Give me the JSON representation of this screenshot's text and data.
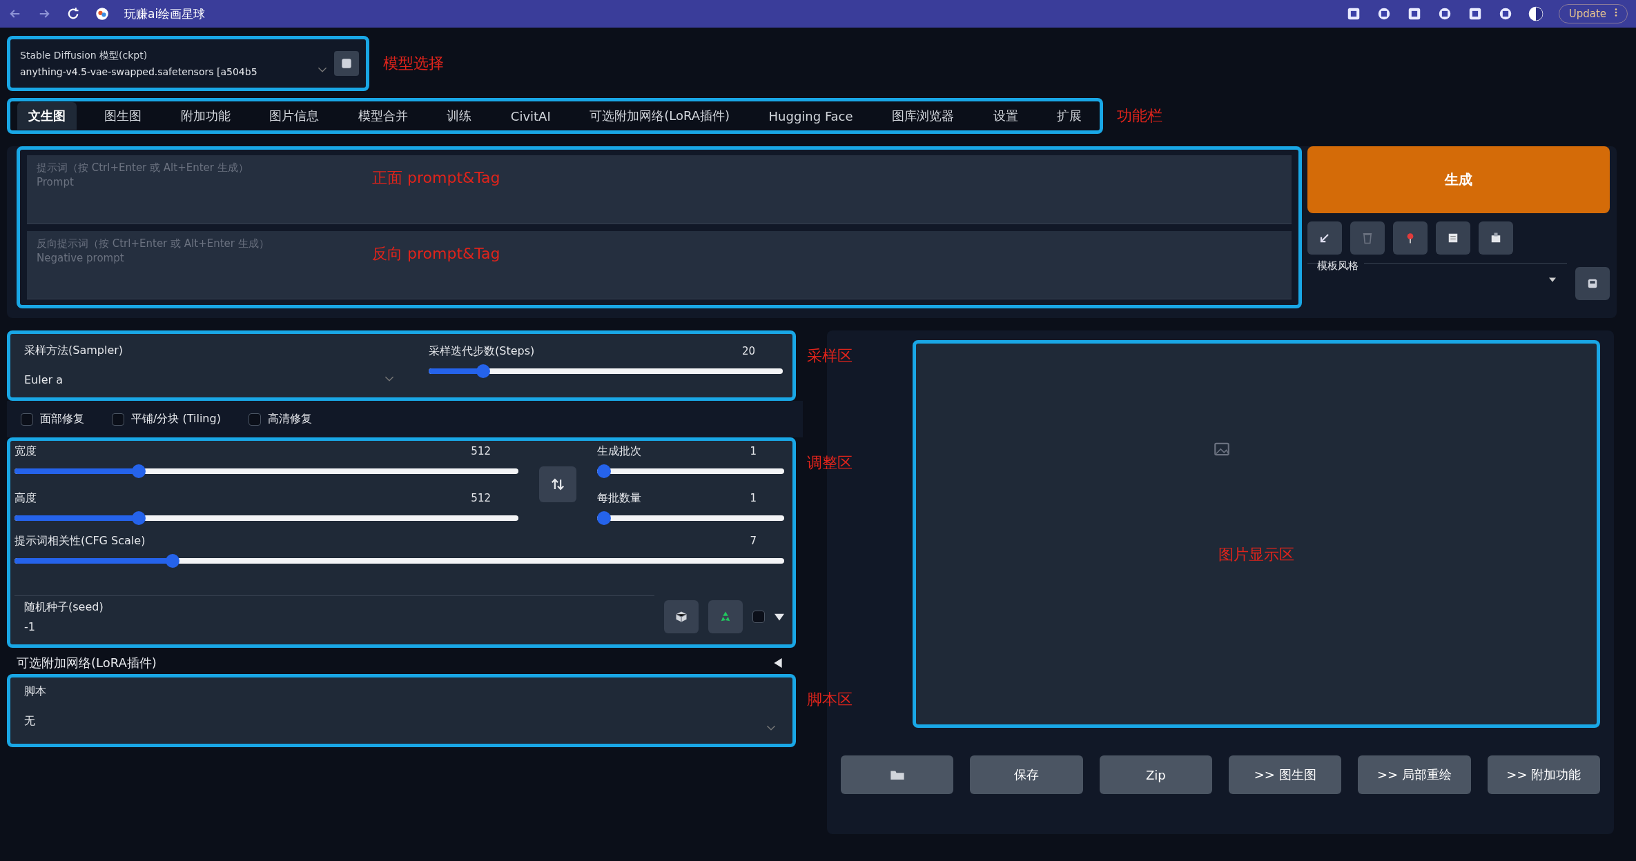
{
  "browser": {
    "tab_title": "玩赚ai绘画星球",
    "update_button": "Update"
  },
  "model_select": {
    "label": "Stable Diffusion 模型(ckpt)",
    "value": "anything-v4.5-vae-swapped.safetensors [a504b5",
    "annotation": "模型选择"
  },
  "tabs": [
    {
      "label": "文生图",
      "selected": true
    },
    {
      "label": "图生图",
      "selected": false
    },
    {
      "label": "附加功能",
      "selected": false
    },
    {
      "label": "图片信息",
      "selected": false
    },
    {
      "label": "模型合并",
      "selected": false
    },
    {
      "label": "训练",
      "selected": false
    },
    {
      "label": "CivitAI",
      "selected": false
    },
    {
      "label": "可选附加网络(LoRA插件)",
      "selected": false
    },
    {
      "label": "Hugging Face",
      "selected": false
    },
    {
      "label": "图库浏览器",
      "selected": false
    },
    {
      "label": "设置",
      "selected": false
    },
    {
      "label": "扩展",
      "selected": false
    }
  ],
  "tabs_annotation": "功能栏",
  "prompts": [
    {
      "placeholder": "提示词（按 Ctrl+Enter 或 Alt+Enter 生成）\nPrompt",
      "annotation": "正面 prompt&Tag"
    },
    {
      "placeholder": "反向提示词（按 Ctrl+Enter 或 Alt+Enter 生成）\nNegative prompt",
      "annotation": "反向 prompt&Tag"
    }
  ],
  "generate_button": "生成",
  "style_select": {
    "label": "模板风格"
  },
  "sampler": {
    "label": "采样方法(Sampler)",
    "value": "Euler a",
    "annotation": "采样区"
  },
  "steps": {
    "label": "采样迭代步数(Steps)",
    "value": "20",
    "level": 0.14
  },
  "checkboxes": [
    {
      "label": "面部修复",
      "checked": false
    },
    {
      "label": "平铺/分块 (Tiling)",
      "checked": false
    },
    {
      "label": "高清修复",
      "checked": false
    }
  ],
  "size_sliders": [
    {
      "label": "宽度",
      "value": "512",
      "level": 0.24
    },
    {
      "label": "高度",
      "value": "512",
      "level": 0.24
    }
  ],
  "batch_sliders": [
    {
      "label": "生成批次",
      "value": "1",
      "level": 0
    },
    {
      "label": "每批数量",
      "value": "1",
      "level": 0
    }
  ],
  "cfg": {
    "label": "提示词相关性(CFG Scale)",
    "value": "7",
    "level": 0.2
  },
  "seed": {
    "label": "随机种子(seed)",
    "value": "-1",
    "extra_checked": false,
    "expanded": false
  },
  "adjust_annotation": "调整区",
  "lora_section": {
    "label": "可选附加网络(LoRA插件)",
    "expanded": false
  },
  "script": {
    "label": "脚本",
    "value": "无",
    "annotation": "脚本区"
  },
  "image_area": {
    "annotation": "图片显示区"
  },
  "output_buttons": [
    {
      "kind": "folder"
    },
    {
      "kind": "text",
      "label": "保存"
    },
    {
      "kind": "text",
      "label": "Zip"
    },
    {
      "kind": "text",
      "label": ">> 图生图"
    },
    {
      "kind": "text",
      "label": ">> 局部重绘"
    },
    {
      "kind": "text",
      "label": ">> 附加功能"
    }
  ]
}
